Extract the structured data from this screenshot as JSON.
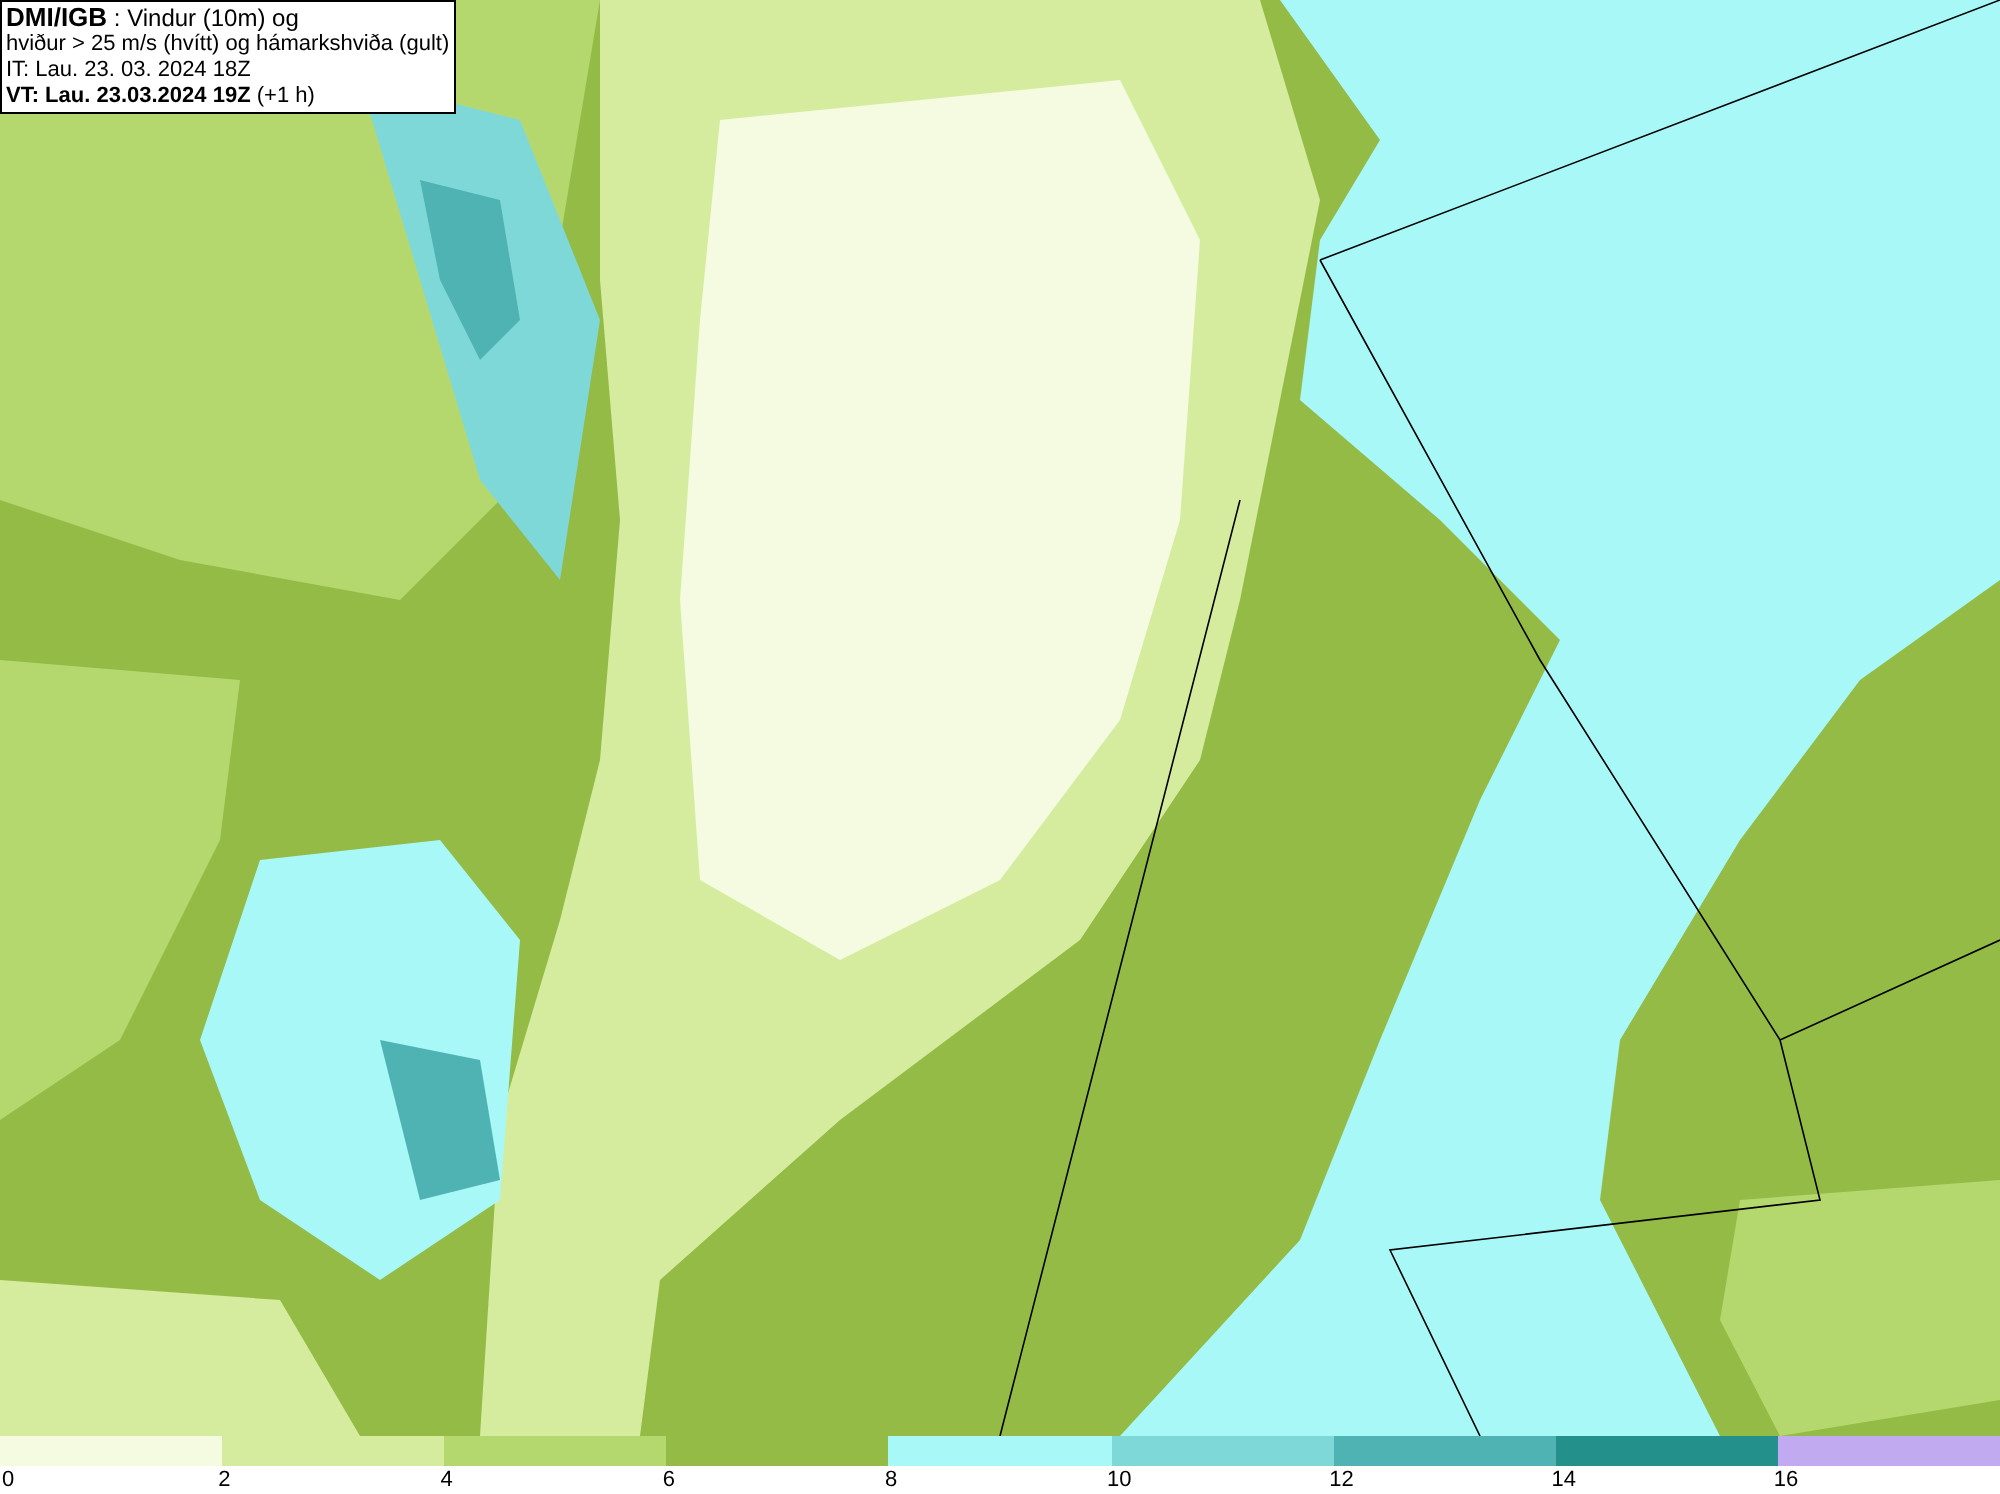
{
  "title_box": {
    "lines": [
      "**DMI/IGB** : Vindur (10m) og",
      "hviður > 25 m/s (hvítt) og hámarkshviða (gult)",
      "IT: Lau. 23. 03. 2024 18Z",
      "**VT: Lau. 23.03.2024 19Z** (+1 h)"
    ]
  },
  "legend": {
    "segments": [
      {
        "color": "#f4fbe1"
      },
      {
        "color": "#d5ec9e"
      },
      {
        "color": "#b5d86e"
      },
      {
        "color": "#93bb46"
      },
      {
        "color": "#a9f8f8"
      },
      {
        "color": "#7fd8d8"
      },
      {
        "color": "#50b3b3"
      },
      {
        "color": "#24908c"
      },
      {
        "color": "#c1aaf0"
      }
    ],
    "ticks": [
      "0",
      "2",
      "4",
      "6",
      "8",
      "10",
      "12",
      "14",
      "16"
    ]
  }
}
